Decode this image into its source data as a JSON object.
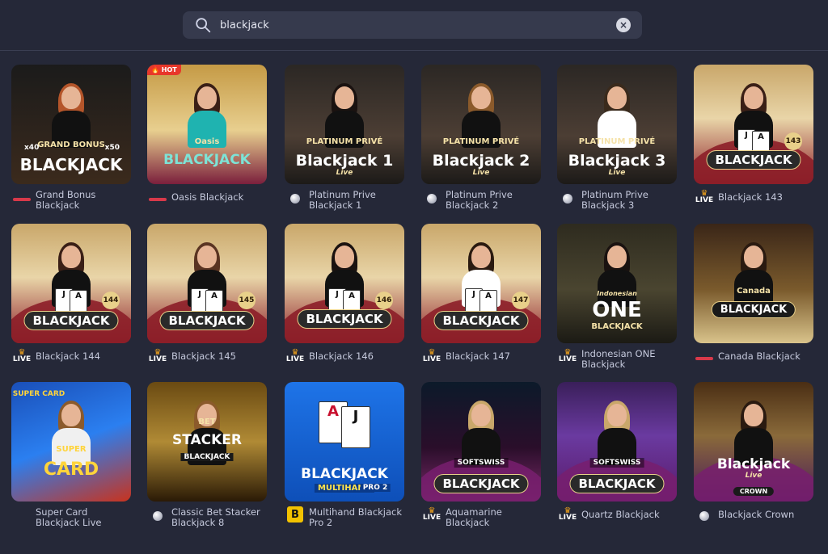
{
  "search": {
    "value": "blackjack",
    "icon": "search-icon",
    "clear_icon": "close-icon"
  },
  "games": [
    {
      "name": "Grand Bonus Blackjack",
      "provider": "evolution",
      "lines": [
        "Grand Bonus",
        "Blackjack"
      ],
      "badge": "",
      "thumb": {
        "title": "BLACKJACK",
        "sub": "GRAND BONUS",
        "x1": "x40",
        "x2": "x50"
      }
    },
    {
      "name": "Oasis Blackjack",
      "provider": "evolution",
      "lines": [
        "Oasis Blackjack"
      ],
      "badge": "HOT",
      "thumb": {
        "title": "BLACKJACK",
        "sub": "Oasis"
      }
    },
    {
      "name": "Platinum Prive Blackjack 1",
      "provider": "spin",
      "lines": [
        "Platinum Prive",
        "Blackjack 1"
      ],
      "badge": "",
      "thumb": {
        "title": "Blackjack 1",
        "sub": "PLATINUM PRIVÉ",
        "tag": "Live"
      }
    },
    {
      "name": "Platinum Prive Blackjack 2",
      "provider": "spin",
      "lines": [
        "Platinum Prive",
        "Blackjack 2"
      ],
      "badge": "",
      "thumb": {
        "title": "Blackjack 2",
        "sub": "PLATINUM PRIVÉ",
        "tag": "Live"
      }
    },
    {
      "name": "Platinum Prive Blackjack 3",
      "provider": "spin",
      "lines": [
        "Platinum Prive",
        "Blackjack 3"
      ],
      "badge": "",
      "thumb": {
        "title": "Blackjack 3",
        "sub": "PLATINUM PRIVÉ",
        "tag": "Live"
      }
    },
    {
      "name": "Blackjack 143",
      "provider": "live",
      "lines": [
        "Blackjack 143"
      ],
      "badge": "",
      "thumb": {
        "title": "BLACKJACK",
        "num": "143"
      }
    },
    {
      "name": "Blackjack 144",
      "provider": "live",
      "lines": [
        "Blackjack 144"
      ],
      "badge": "",
      "thumb": {
        "title": "BLACKJACK",
        "num": "144"
      }
    },
    {
      "name": "Blackjack 145",
      "provider": "live",
      "lines": [
        "Blackjack 145"
      ],
      "badge": "",
      "thumb": {
        "title": "BLACKJACK",
        "num": "145"
      }
    },
    {
      "name": "Blackjack 146",
      "provider": "live",
      "lines": [
        "Blackjack 146"
      ],
      "badge": "",
      "thumb": {
        "title": "BLACKJACK",
        "num": "146"
      }
    },
    {
      "name": "Blackjack 147",
      "provider": "live",
      "lines": [
        "Blackjack 147"
      ],
      "badge": "",
      "thumb": {
        "title": "BLACKJACK",
        "num": "147"
      }
    },
    {
      "name": "Indonesian ONE Blackjack",
      "provider": "live",
      "lines": [
        "Indonesian ONE",
        "Blackjack"
      ],
      "badge": "",
      "thumb": {
        "title": "ONE",
        "sub": "BLACKJACK",
        "tag": "Indonesian"
      }
    },
    {
      "name": "Canada Blackjack",
      "provider": "evolution",
      "lines": [
        "Canada Blackjack"
      ],
      "badge": "",
      "thumb": {
        "title": "BLACKJACK",
        "sub": "Canada"
      }
    },
    {
      "name": "Super Card Blackjack Live",
      "provider": "none",
      "lines": [
        "Super Card",
        "Blackjack Live"
      ],
      "badge": "",
      "thumb": {
        "title": "CARD",
        "sub": "SUPER",
        "tag": "SUPER CARD"
      }
    },
    {
      "name": "Classic Bet Stacker Blackjack 8",
      "provider": "spin",
      "lines": [
        "Classic Bet Stacker",
        "Blackjack 8"
      ],
      "badge": "",
      "thumb": {
        "title": "STACKER",
        "sub": "BET",
        "tag": "BLACKJACK"
      }
    },
    {
      "name": "Multihand Blackjack Pro 2",
      "provider": "bgaming",
      "lines": [
        "Multihand Blackjack",
        "Pro 2"
      ],
      "badge": "",
      "thumb": {
        "title": "BLACKJACK",
        "sub": "MULTIHAND",
        "tag": "PRO 2",
        "c1": "A",
        "c2": "J"
      }
    },
    {
      "name": "Aquamarine Blackjack",
      "provider": "live",
      "lines": [
        "Aquamarine",
        "Blackjack"
      ],
      "badge": "",
      "thumb": {
        "title": "BLACKJACK",
        "sub": "SOFTSWISS"
      }
    },
    {
      "name": "Quartz Blackjack",
      "provider": "live",
      "lines": [
        "Quartz Blackjack"
      ],
      "badge": "",
      "thumb": {
        "title": "BLACKJACK",
        "sub": "SOFTSWISS"
      }
    },
    {
      "name": "Blackjack Crown",
      "provider": "spin",
      "lines": [
        "Blackjack Crown"
      ],
      "badge": "",
      "thumb": {
        "title": "Blackjack",
        "sub": "CROWN",
        "tag": "Live"
      }
    }
  ],
  "provider_labels": {
    "live": "LIVE",
    "bgaming": "B"
  }
}
